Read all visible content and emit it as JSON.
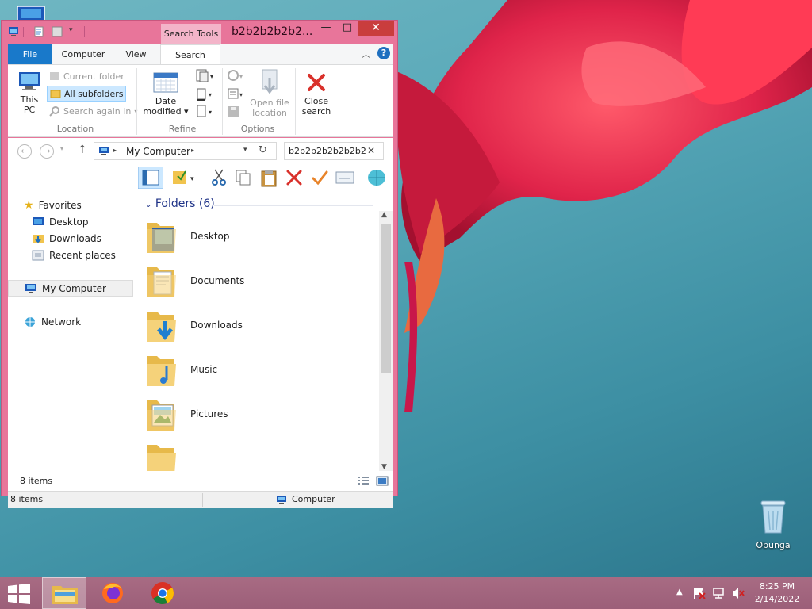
{
  "window": {
    "title": "b2b2b2b2b2...",
    "context_tab": "Search Tools",
    "controls": {
      "minimize": "—",
      "maximize": "□",
      "close": "✕"
    }
  },
  "ribbon": {
    "tabs": [
      "File",
      "Computer",
      "View",
      "Search"
    ],
    "active_tab": "Search",
    "help": "?",
    "groups": {
      "location": {
        "label": "Location",
        "this_pc": "This PC",
        "current_folder": "Current folder",
        "all_subfolders": "All subfolders",
        "search_again_in": "Search again in"
      },
      "refine": {
        "label": "Refine",
        "date_modified_line1": "Date",
        "date_modified_line2": "modified"
      },
      "options": {
        "label": "Options",
        "open_file_location_line1": "Open file",
        "open_file_location_line2": "location"
      },
      "close": {
        "line1": "Close",
        "line2": "search"
      }
    }
  },
  "address": {
    "path": "My Computer",
    "search_value": "b2b2b2b2b2b2b2"
  },
  "nav_pane": {
    "favorites": "Favorites",
    "desktop": "Desktop",
    "downloads": "Downloads",
    "recent": "Recent places",
    "my_computer": "My Computer",
    "network": "Network"
  },
  "content": {
    "group_header": "Folders (6)",
    "folders": [
      "Desktop",
      "Documents",
      "Downloads",
      "Music",
      "Pictures"
    ]
  },
  "status": {
    "inner_count": "8 items",
    "outer_count": "8 items",
    "location": "Computer"
  },
  "desktop": {
    "recycle_bin_label": "Obunga"
  },
  "taskbar": {
    "time": "8:25 PM",
    "date": "2/14/2022"
  },
  "colors": {
    "window_frame": "#e8759a",
    "file_tab": "#1979ca",
    "taskbar": "#a86b83",
    "close_button": "#c93d3d"
  }
}
